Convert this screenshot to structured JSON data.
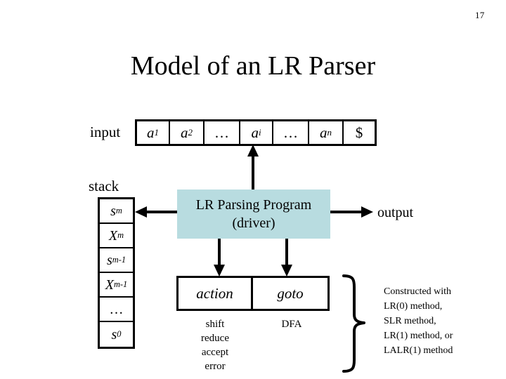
{
  "slide": {
    "page_number": "17",
    "title": "Model of an LR Parser",
    "accent_color": "#b8dce0",
    "line_color": "#000000",
    "background": "#ffffff"
  },
  "input_tape": {
    "label": "input",
    "cells": [
      {
        "text": "a",
        "sub": "1"
      },
      {
        "text": "a",
        "sub": "2"
      },
      {
        "text": "…",
        "sub": ""
      },
      {
        "text": "a",
        "sub": "i"
      },
      {
        "text": "…",
        "sub": ""
      },
      {
        "text": "a",
        "sub": "n"
      },
      {
        "text": "$",
        "sub": ""
      }
    ]
  },
  "stack": {
    "label": "stack",
    "cells": [
      {
        "text": "s",
        "sub": "m"
      },
      {
        "text": "X",
        "sub": "m"
      },
      {
        "text": "s",
        "sub": "m-1"
      },
      {
        "text": "X",
        "sub": "m-1"
      },
      {
        "text": "…",
        "sub": ""
      },
      {
        "text": "s",
        "sub": "0"
      }
    ]
  },
  "driver": {
    "line1": "LR Parsing Program",
    "line2": "(driver)"
  },
  "table": {
    "action_label": "action",
    "goto_label": "goto",
    "action_details": [
      "shift",
      "reduce",
      "accept",
      "error"
    ],
    "goto_details": [
      "DFA"
    ]
  },
  "output": {
    "label": "output"
  },
  "note": {
    "lines": [
      "Constructed with",
      "LR(0) method,",
      "SLR method,",
      "LR(1) method, or",
      "LALR(1) method"
    ]
  },
  "icons": {
    "arrow_up_to_input": "arrow-up-icon",
    "arrow_left_to_stack": "arrow-left-icon",
    "arrow_right_to_output": "arrow-right-icon",
    "arrow_down_action": "arrow-down-icon",
    "arrow_down_goto": "arrow-down-icon",
    "brace": "curly-brace-icon"
  }
}
